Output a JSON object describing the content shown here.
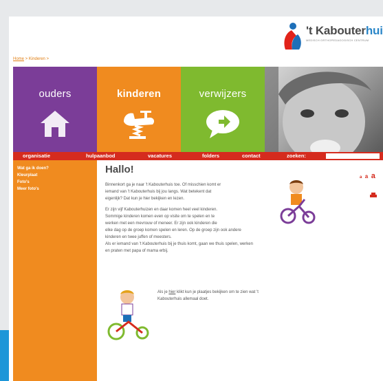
{
  "logo": {
    "brand_prefix": "'t Kabouter",
    "brand_suffix": "huis",
    "tagline": "MEDISCH ORTHOPEDAGOGISCH CENTRUM"
  },
  "breadcrumb": {
    "home": "Home",
    "sep1": " > ",
    "current": "Kinderen",
    "sep2": " >"
  },
  "tiles": [
    {
      "label": "ouders",
      "icon": "house-icon"
    },
    {
      "label": "kinderen",
      "icon": "spring-rider-icon"
    },
    {
      "label": "verwijzers",
      "icon": "speech-bubble-arrow-icon"
    }
  ],
  "nav": {
    "items": [
      "organisatie",
      "hulpaanbod",
      "vacatures",
      "folders",
      "contact"
    ],
    "search_label": "zoeken:",
    "search_value": ""
  },
  "sidebar": {
    "items": [
      "Wat ga ik doen?",
      "Kleurplaat",
      "Foto's",
      "Meer foto's"
    ]
  },
  "content": {
    "title": "Hallo!",
    "p1": [
      "Binnenkort ga je naar 't Kabouterhuis toe. Of misschien komt er",
      "iemand van 't Kabouterhuis bij jou langs. Wat betekent dat",
      "eigenlijk? Dat kun je hier bekijken en lezen."
    ],
    "p2": [
      "Er zijn vijf Kabouterhuizen en daar komen heel veel kinderen.",
      "Sommige kinderen komen  even op visite om te spelen en te",
      "werken met een mevrouw of meneer. Er zijn ook kinderen die",
      "elke dag op de groep komen spelen en leren. Op de groep zijn ook andere",
      "kinderen en twee juffen of meesters.",
      "Als er iemand van 't Kabouterhuis bij je thuis komt, gaan we thuis spelen, werken",
      "en praten met papa of mama erbij."
    ],
    "p3_line1_pre": "Als je ",
    "p3_link": "hier",
    "p3_line1_post": " klikt kun je plaatjes bekijken om te zien wat 't",
    "p3_line2": "Kabouterhuis allemaal doet."
  },
  "tools": {
    "font_small": "a",
    "font_medium": "a",
    "font_large": "a",
    "print_icon": "printer-icon"
  },
  "colors": {
    "purple": "#7b3d98",
    "orange": "#f08b1f",
    "green": "#7fba2f",
    "red": "#d52b1e",
    "blue": "#1d96d8"
  }
}
